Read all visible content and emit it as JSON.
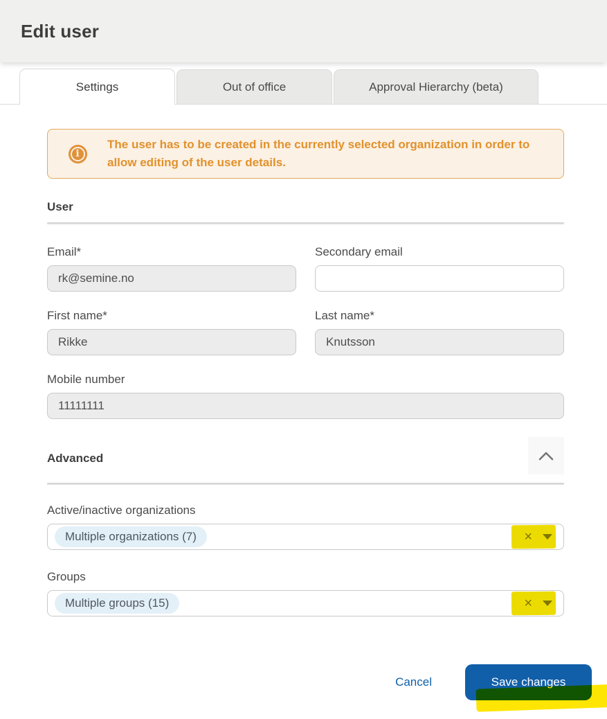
{
  "window": {
    "title": "Edit user"
  },
  "tabs": [
    {
      "label": "Settings",
      "active": true
    },
    {
      "label": "Out of office",
      "active": false
    },
    {
      "label": "Approval Hierarchy (beta)",
      "active": false
    }
  ],
  "banner": {
    "icon": "info-icon",
    "icon_glyph": "i",
    "text": "The user has to be created in the currently selected organization in order to allow editing of the user details."
  },
  "sections": {
    "user_heading": "User",
    "advanced_heading": "Advanced"
  },
  "fields": {
    "email": {
      "label": "Email*",
      "value": "rk@semine.no",
      "disabled": true
    },
    "secondary_email": {
      "label": "Secondary email",
      "value": "",
      "disabled": false
    },
    "first_name": {
      "label": "First name*",
      "value": "Rikke",
      "disabled": true
    },
    "last_name": {
      "label": "Last name*",
      "value": "Knutsson",
      "disabled": true
    },
    "mobile_number": {
      "label": "Mobile number",
      "value": "11111111",
      "disabled": true
    },
    "organizations": {
      "label": "Active/inactive organizations",
      "chip": "Multiple organizations (7)"
    },
    "groups": {
      "label": "Groups",
      "chip": "Multiple groups (15)"
    }
  },
  "icons": {
    "clear_glyph": "×",
    "caret": "caret-down",
    "collapse": "chevron-up"
  },
  "footer": {
    "cancel_label": "Cancel",
    "save_label": "Save changes"
  },
  "colors": {
    "accent_blue": "#115fa8",
    "banner_text_orange": "#e2912d",
    "banner_bg": "#fbf1e4",
    "banner_border": "#e3a95e",
    "chip_bg": "#e4f0f8",
    "disabled_input_bg": "#ececec",
    "annotation_highlight_yellow": "#ffe503"
  }
}
